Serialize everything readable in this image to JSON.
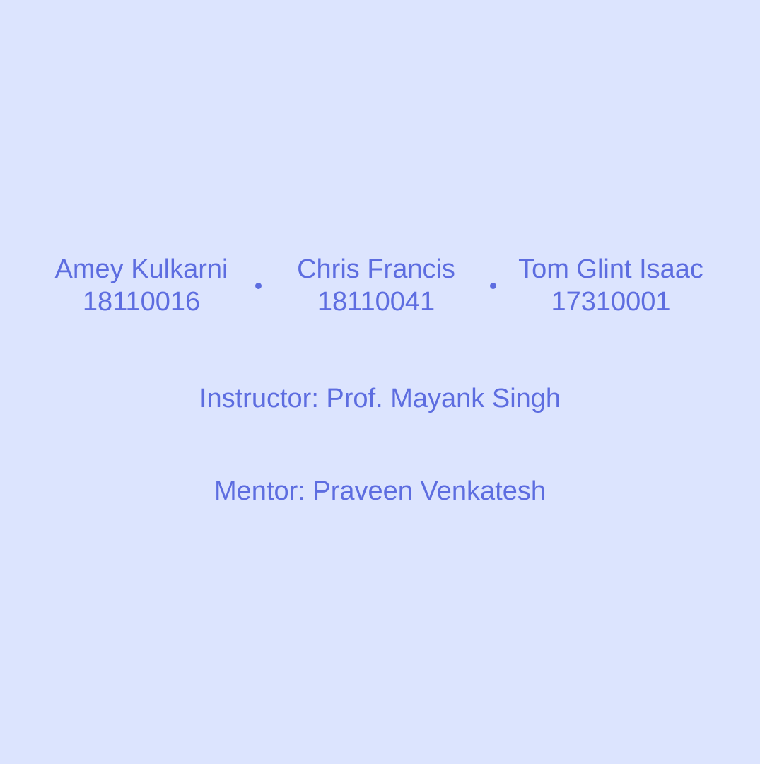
{
  "members": [
    {
      "name": "Amey Kulkarni",
      "id": "18110016"
    },
    {
      "name": "Chris Francis",
      "id": "18110041"
    },
    {
      "name": "Tom Glint Isaac",
      "id": "17310001"
    }
  ],
  "instructor": "Instructor: Prof. Mayank Singh",
  "mentor": "Mentor: Praveen Venkatesh",
  "colors": {
    "background": "#dce4fe",
    "text": "#5d6de0"
  },
  "icons": {
    "separator": "dot-separator-icon"
  }
}
